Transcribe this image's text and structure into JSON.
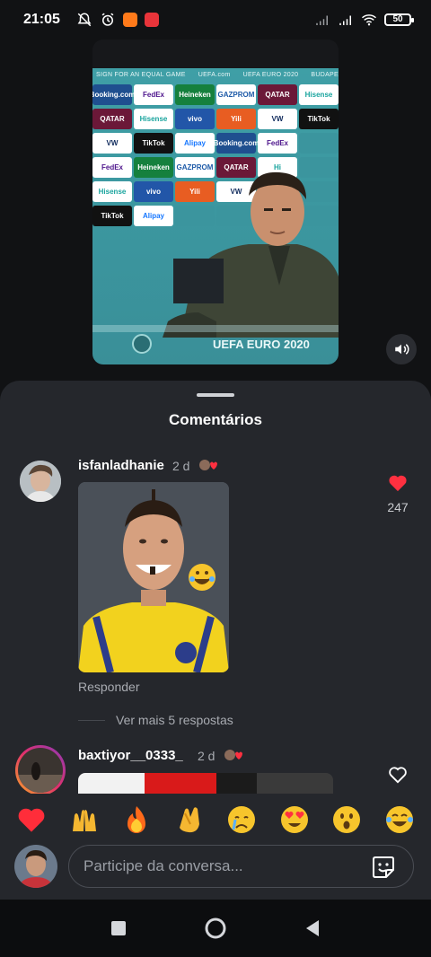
{
  "status": {
    "time": "21:05",
    "battery": "50"
  },
  "video": {
    "board_header": [
      "SIGN FOR AN EQUAL GAME",
      "UEFA.com",
      "UEFA EURO 2020",
      "BUDAPE"
    ],
    "logos": [
      {
        "text": "Booking.com",
        "bg": "#1f4f8f"
      },
      {
        "text": "FedEx",
        "bg": "#ffffff",
        "fg": "#4d148c"
      },
      {
        "text": "Heineken",
        "bg": "#15803d"
      },
      {
        "text": "GAZPROM",
        "bg": "#ffffff",
        "fg": "#1d5aa8"
      },
      {
        "text": "QATAR",
        "bg": "#6b1838"
      },
      {
        "text": "Hisense",
        "bg": "#ffffff",
        "fg": "#19a49e"
      },
      {
        "text": "QATAR",
        "bg": "#6b1838"
      },
      {
        "text": "Hisense",
        "bg": "#ffffff",
        "fg": "#19a49e"
      },
      {
        "text": "vivo",
        "bg": "#2256a8"
      },
      {
        "text": "Yili",
        "bg": "#e85d22"
      },
      {
        "text": "VW",
        "bg": "#ffffff",
        "fg": "#0f2a5c"
      },
      {
        "text": "TikTok",
        "bg": "#111111"
      },
      {
        "text": "VW",
        "bg": "#ffffff",
        "fg": "#0f2a5c"
      },
      {
        "text": "TikTok",
        "bg": "#111111"
      },
      {
        "text": "Alipay",
        "bg": "#ffffff",
        "fg": "#1677ff"
      },
      {
        "text": "Booking.com",
        "bg": "#1f4f8f"
      },
      {
        "text": "FedEx",
        "bg": "#ffffff",
        "fg": "#4d148c"
      },
      {
        "text": "",
        "bg": "#3b959e"
      },
      {
        "text": "FedEx",
        "bg": "#ffffff",
        "fg": "#4d148c"
      },
      {
        "text": "Heineken",
        "bg": "#15803d"
      },
      {
        "text": "GAZPROM",
        "bg": "#ffffff",
        "fg": "#1d5aa8"
      },
      {
        "text": "QATAR",
        "bg": "#6b1838"
      },
      {
        "text": "Hi",
        "bg": "#ffffff",
        "fg": "#19a49e"
      },
      {
        "text": "",
        "bg": "#3b959e"
      },
      {
        "text": "Hisense",
        "bg": "#ffffff",
        "fg": "#19a49e"
      },
      {
        "text": "vivo",
        "bg": "#2256a8"
      },
      {
        "text": "Yili",
        "bg": "#e85d22"
      },
      {
        "text": "VW",
        "bg": "#ffffff",
        "fg": "#0f2a5c"
      },
      {
        "text": "",
        "bg": "#3b959e"
      },
      {
        "text": "",
        "bg": "#3b959e"
      },
      {
        "text": "TikTok",
        "bg": "#111111"
      },
      {
        "text": "Alipay",
        "bg": "#ffffff",
        "fg": "#1677ff"
      },
      {
        "text": "",
        "bg": "#3b959e"
      },
      {
        "text": "",
        "bg": "#3b959e"
      },
      {
        "text": "",
        "bg": "#3b959e"
      },
      {
        "text": "",
        "bg": "#3b959e"
      }
    ],
    "euro_text": "UEFA EURO 2020"
  },
  "sheet": {
    "title": "Comentários"
  },
  "comments": [
    {
      "username": "isfanladhanie",
      "time": "2 d",
      "likes": "247",
      "liked": true,
      "reply_label": "Responder",
      "more_replies": "Ver mais 5 respostas"
    },
    {
      "username": "baxtiyor__0333_",
      "time": "2 d",
      "liked": false
    }
  ],
  "reactions": [
    "heart",
    "raised-hands",
    "fire",
    "clapping-hands",
    "crying-face",
    "heart-eyes",
    "surprised-face",
    "tears-of-joy"
  ],
  "composer": {
    "placeholder": "Participe da conversa..."
  },
  "colors": {
    "sheet_bg": "#25272c",
    "like_red": "#ff3040",
    "muted_text": "#a8abb1"
  }
}
